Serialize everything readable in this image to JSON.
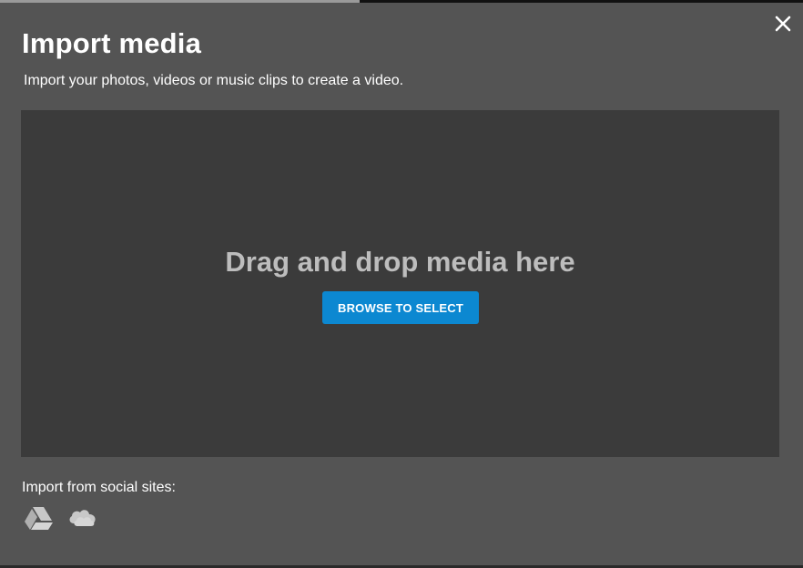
{
  "dialog": {
    "title": "Import media",
    "subtitle": "Import your photos, videos or music clips to create a video.",
    "close_icon": "close-icon"
  },
  "dropzone": {
    "text": "Drag and drop media here",
    "browse_label": "BROWSE TO SELECT"
  },
  "social": {
    "label": "Import from social sites:",
    "providers": [
      {
        "icon": "google-drive-icon"
      },
      {
        "icon": "onedrive-icon"
      }
    ]
  },
  "colors": {
    "modal_background": "#545454",
    "dropzone_background": "#3b3b3b",
    "accent_button": "#0c88d1",
    "icon_gray": "#c8c8c8"
  }
}
